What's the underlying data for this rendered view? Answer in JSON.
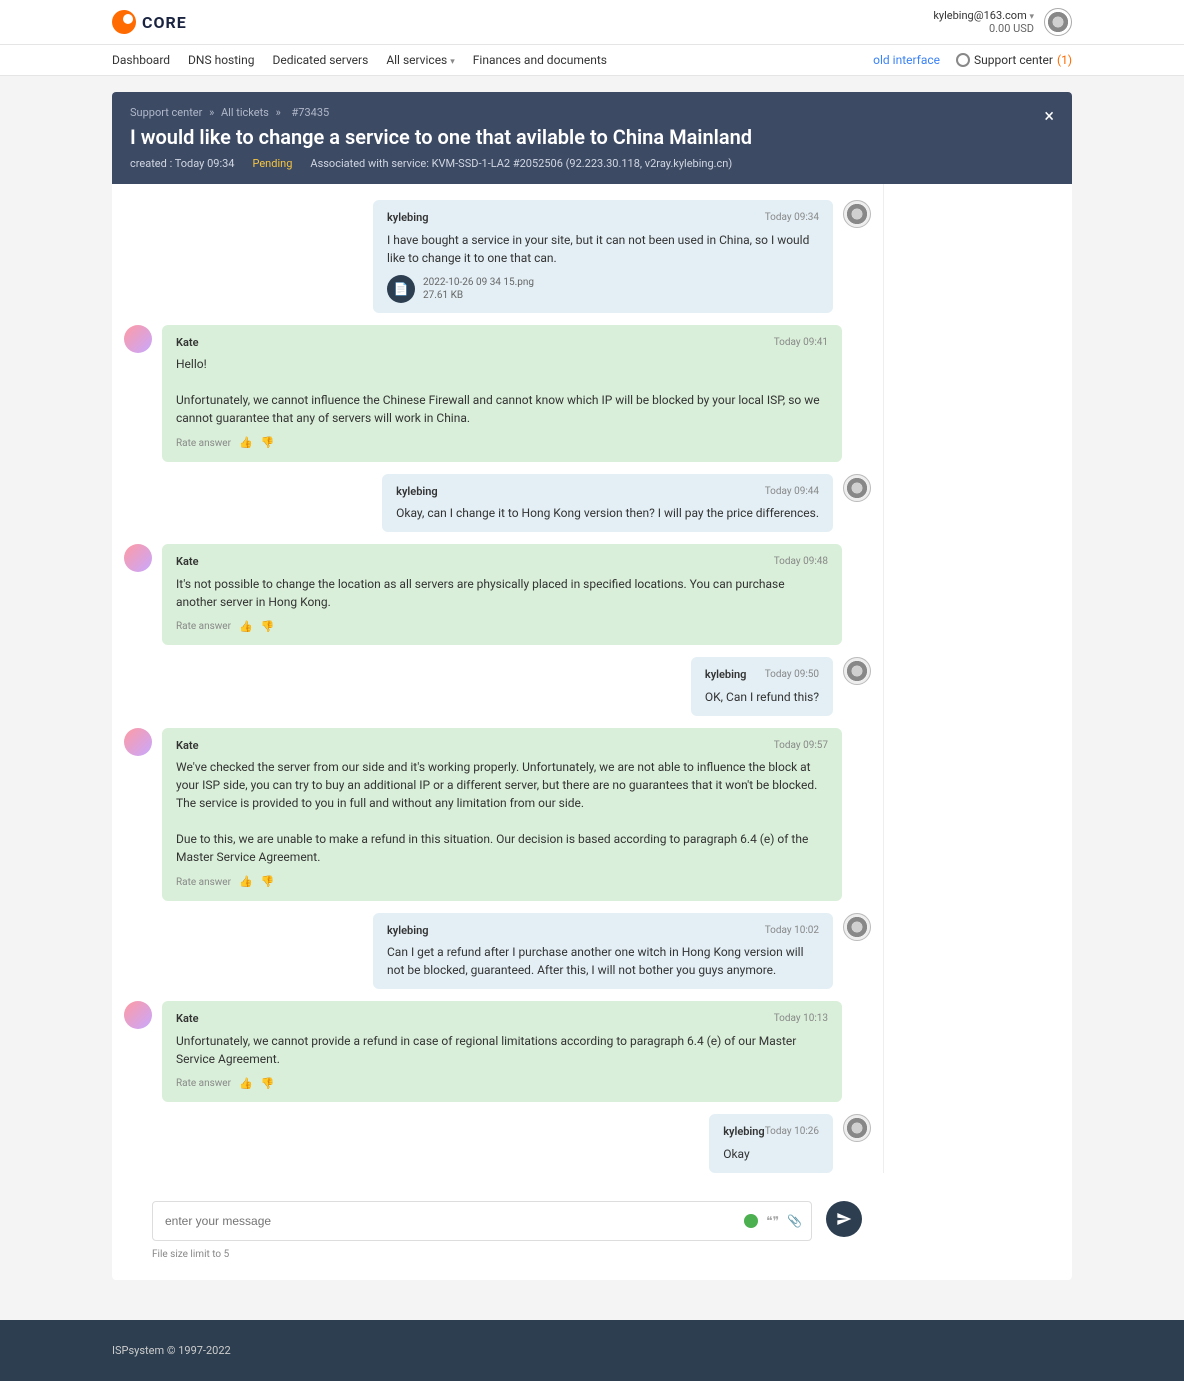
{
  "header": {
    "logo_text": "CORE",
    "user_email": "kylebing@163.com",
    "balance": "0.00 USD"
  },
  "nav": {
    "items": [
      "Dashboard",
      "DNS hosting",
      "Dedicated servers",
      "All services",
      "Finances and documents"
    ],
    "old_interface": "old interface",
    "support_label": "Support center",
    "support_count": "(1)"
  },
  "breadcrumb": {
    "a": "Support center",
    "b": "All tickets",
    "c": "#73435"
  },
  "ticket": {
    "title": "I would like to change a service to one that avilable to China Mainland",
    "created": "created : Today 09:34",
    "status": "Pending",
    "assoc": "Associated with service: KVM-SSD-1-LA2 #2052506 (92.223.30.118, v2ray.kylebing.cn)"
  },
  "messages": [
    {
      "side": "mine",
      "author": "kylebing",
      "time": "Today 09:34",
      "body": "I have bought a service in your site, but it can not been used in China, so I would like to change it to one that can.",
      "attachment": {
        "name": "2022-10-26 09 34 15.png",
        "size": "27.61 KB"
      }
    },
    {
      "side": "agent",
      "author": "Kate",
      "time": "Today 09:41",
      "body": "Hello!\n\nUnfortunately, we cannot influence the Chinese Firewall and cannot know which IP will be blocked by your local ISP, so we cannot guarantee that any of servers will work in China.",
      "rate": true
    },
    {
      "side": "mine",
      "author": "kylebing",
      "time": "Today 09:44",
      "body": "Okay, can I change it to Hong Kong version then? I will pay the price differences."
    },
    {
      "side": "agent",
      "author": "Kate",
      "time": "Today 09:48",
      "body": "It's not possible to change the location as all servers are physically placed in specified locations. You can purchase another server in Hong Kong.",
      "rate": true
    },
    {
      "side": "mine",
      "author": "kylebing",
      "time": "Today 09:50",
      "body": "OK, Can I refund this?"
    },
    {
      "side": "agent",
      "author": "Kate",
      "time": "Today 09:57",
      "body": "We've checked the server from our side and it's working properly. Unfortunately, we are not able to influence the block at your ISP side, you can try to buy an additional IP or a different server, but there are no guarantees that it won't be blocked. The service is provided to you in full and without any limitation from our side.\n\nDue to this, we are unable to make a refund in this situation. Our decision is based according to paragraph 6.4 (e) of the Master Service Agreement.",
      "rate": true
    },
    {
      "side": "mine",
      "author": "kylebing",
      "time": "Today 10:02",
      "body": "Can I get a refund after I purchase another one witch in Hong Kong version will not be blocked, guaranteed. After this, I will not bother you guys anymore."
    },
    {
      "side": "agent",
      "author": "Kate",
      "time": "Today 10:13",
      "body": "Unfortunately, we cannot provide a refund in case of regional limitations according to paragraph 6.4 (e) of our Master Service Agreement.",
      "rate": true
    },
    {
      "side": "mine",
      "author": "kylebing",
      "time": "Today 10:26",
      "body": "Okay"
    }
  ],
  "compose": {
    "placeholder": "enter your message",
    "file_hint": "File size limit to 5"
  },
  "labels": {
    "rate": "Rate answer"
  },
  "footer": {
    "copyright": "ISPsystem © 1997-2022"
  }
}
